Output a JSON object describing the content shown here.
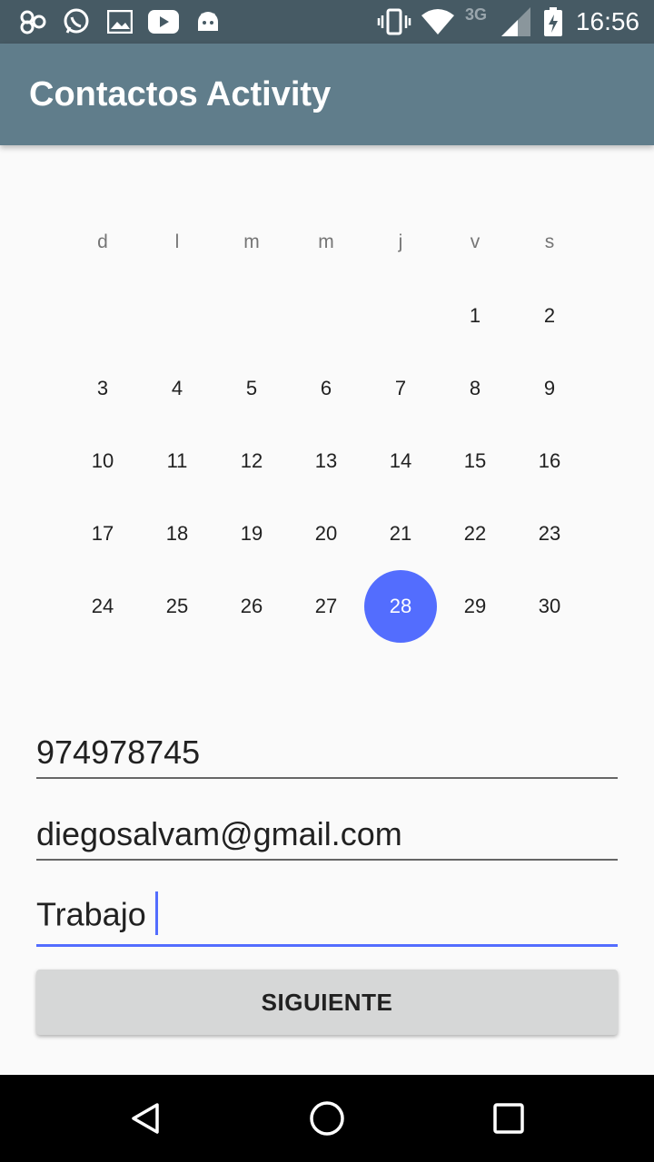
{
  "status_bar": {
    "time": "16:56",
    "network_label": "3G",
    "icons": [
      "infinity-icon",
      "whatsapp-icon",
      "gallery-icon",
      "youtube-icon",
      "android-icon",
      "vibrate-icon",
      "wifi-icon",
      "signal-icon",
      "battery-charging-icon"
    ]
  },
  "app_bar": {
    "title": "Contactos Activity"
  },
  "calendar": {
    "weekdays": [
      "d",
      "l",
      "m",
      "m",
      "j",
      "v",
      "s"
    ],
    "weeks": [
      [
        "",
        "",
        "",
        "",
        "",
        "1",
        "2"
      ],
      [
        "3",
        "4",
        "5",
        "6",
        "7",
        "8",
        "9"
      ],
      [
        "10",
        "11",
        "12",
        "13",
        "14",
        "15",
        "16"
      ],
      [
        "17",
        "18",
        "19",
        "20",
        "21",
        "22",
        "23"
      ],
      [
        "24",
        "25",
        "26",
        "27",
        "28",
        "29",
        "30"
      ]
    ],
    "selected_day": "28",
    "accent_color": "#536dfe"
  },
  "form": {
    "phone_value": "974978745",
    "email_value": "diegosalvam@gmail.com",
    "description_value": "Trabajo",
    "next_button_label": "SIGUIENTE"
  },
  "nav_bar": {
    "icons": [
      "back-icon",
      "home-icon",
      "recents-icon"
    ]
  }
}
